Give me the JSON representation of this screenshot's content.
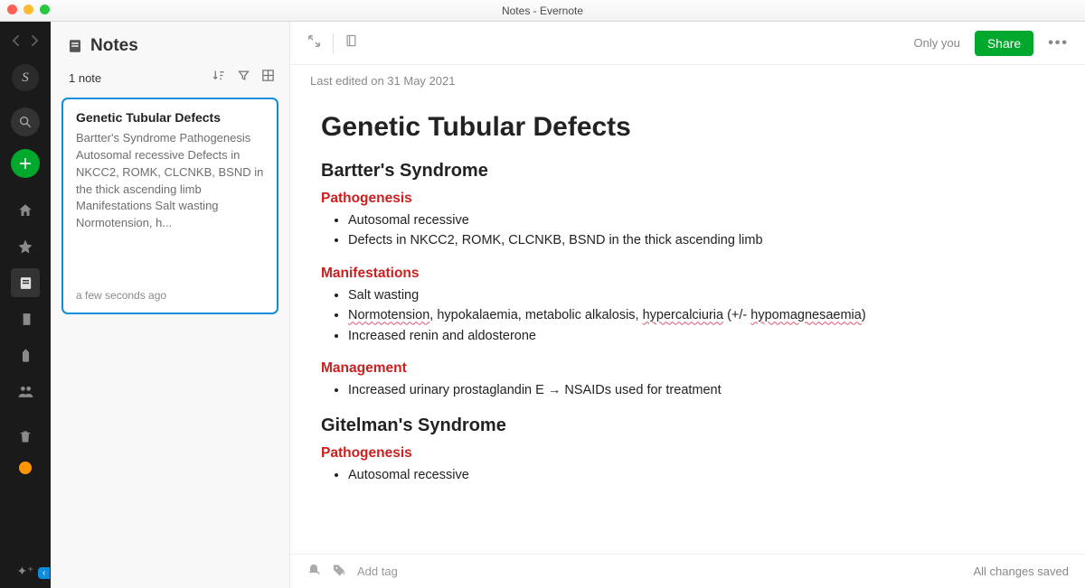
{
  "window": {
    "title": "Notes - Evernote"
  },
  "rail": {
    "icons": [
      "home",
      "star",
      "notes",
      "notebooks",
      "tag",
      "shared",
      "trash"
    ]
  },
  "panel": {
    "title": "Notes",
    "count_label": "1 note",
    "card": {
      "title": "Genetic Tubular Defects",
      "snippet": "Bartter's Syndrome Pathogenesis Autosomal recessive Defects in NKCC2, ROMK, CLCNKB, BSND in the thick ascending limb Manifestations Salt wasting Normotension, h...",
      "time": "a few seconds ago"
    }
  },
  "editor": {
    "only_you": "Only you",
    "share": "Share",
    "last_edited": "Last edited on 31 May 2021",
    "title": "Genetic Tubular Defects",
    "bartter_heading": "Bartter's Syndrome",
    "pathogenesis_label": "Pathogenesis",
    "bartter_path_items": [
      "Autosomal recessive",
      "Defects in NKCC2, ROMK, CLCNKB, BSND in the thick ascending limb"
    ],
    "manifestations_label": "Manifestations",
    "manifest_item1": "Salt wasting",
    "manifest_item2_a": "Normotension",
    "manifest_item2_b": ", hypokalaemia, metabolic alkalosis, ",
    "manifest_item2_c": "hypercalciuria",
    "manifest_item2_d": " (+/- ",
    "manifest_item2_e": "hypomagnesaemia",
    "manifest_item2_f": ")",
    "manifest_item3": "Increased renin and aldosterone",
    "management_label": "Management",
    "management_item": "Increased urinary prostaglandin E → NSAIDs used for treatment",
    "gitelman_heading": "Gitelman's Syndrome",
    "gitelman_path_item": "Autosomal recessive",
    "footer": {
      "add_tag": "Add tag",
      "status": "All changes saved"
    }
  }
}
